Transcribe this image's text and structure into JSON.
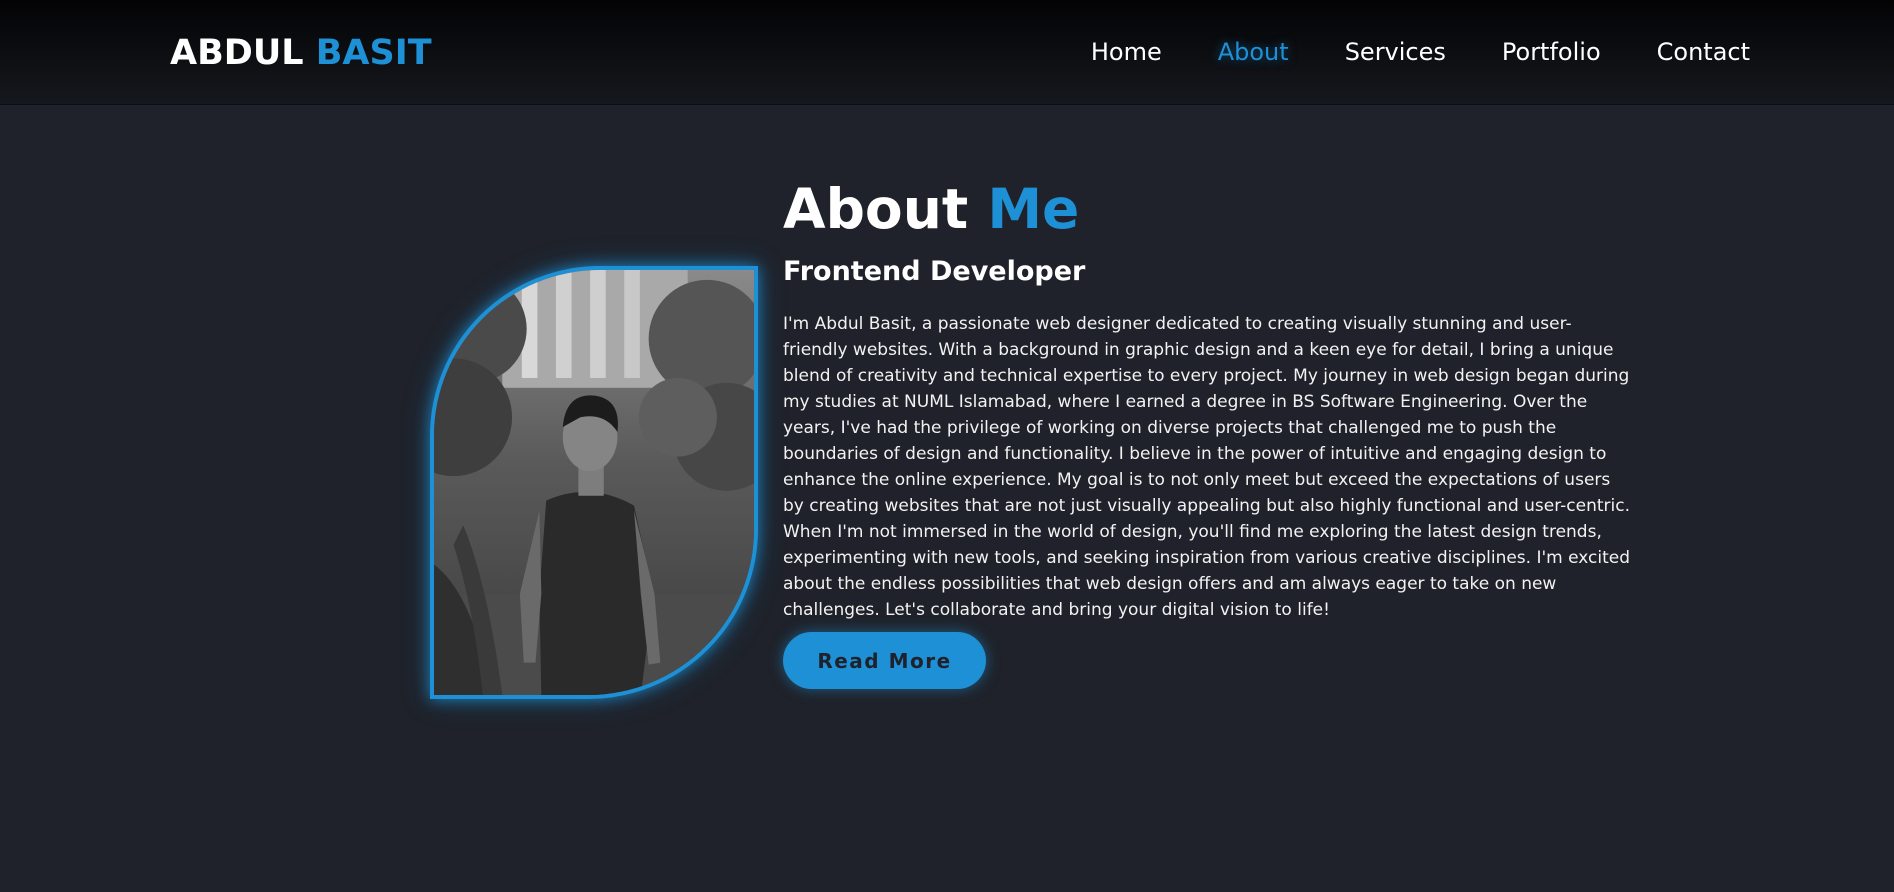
{
  "header": {
    "logo_first": "ABDUL",
    "logo_second": "BASIT",
    "nav": [
      {
        "label": "Home"
      },
      {
        "label": "About"
      },
      {
        "label": "Services"
      },
      {
        "label": "Portfolio"
      },
      {
        "label": "Contact"
      }
    ],
    "active_nav": "About"
  },
  "about": {
    "title_first": "About",
    "title_second": "Me",
    "role": "Frontend Developer",
    "bio": "I'm Abdul Basit, a passionate web designer dedicated to creating visually stunning and user-friendly websites. With a background in graphic design and a keen eye for detail, I bring a unique blend of creativity and technical expertise to every project. My journey in web design began during my studies at NUML Islamabad, where I earned a degree in BS Software Engineering. Over the years, I've had the privilege of working on diverse projects that challenged me to push the boundaries of design and functionality. I believe in the power of intuitive and engaging design to enhance the online experience. My goal is to not only meet but exceed the expectations of users by creating websites that are not just visually appealing but also highly functional and user-centric. When I'm not immersed in the world of design, you'll find me exploring the latest design trends, experimenting with new tools, and seeking inspiration from various creative disciplines. I'm excited about the endless possibilities that web design offers and am always eager to take on new challenges. Let's collaborate and bring your digital vision to life!",
    "button_label": "Read More"
  },
  "colors": {
    "accent": "#1e90d6",
    "background": "#1f222a",
    "header_top": "#030304"
  }
}
